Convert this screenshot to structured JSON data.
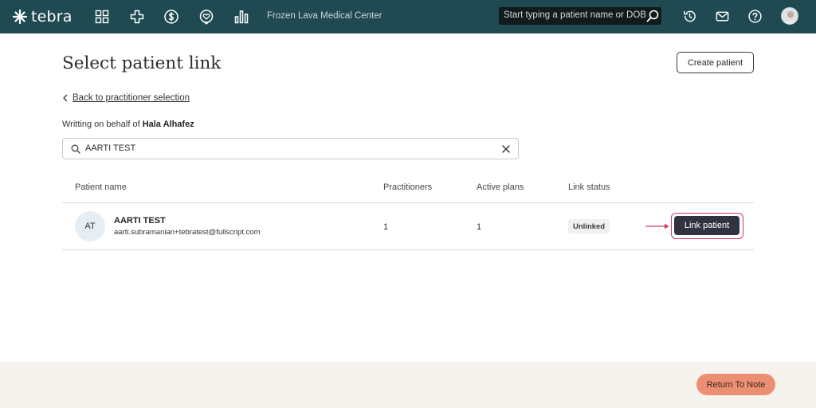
{
  "app": {
    "brand": "tebra",
    "clinic_name": "Frozen Lava Medical Center",
    "search_placeholder": "Start typing a patient name or DOB",
    "nav_icons": [
      "dashboard-grid-icon",
      "medical-cross-icon",
      "billing-dollar-icon",
      "heart-care-icon",
      "reports-chart-icon"
    ],
    "right_icons": [
      "history-icon",
      "mail-icon",
      "help-icon"
    ]
  },
  "page": {
    "title": "Select patient link",
    "create_button": "Create patient",
    "back_link": "Back to practitioner selection",
    "behalf_prefix": "Writting on behalf of ",
    "behalf_name": "Hala Alhafez"
  },
  "search": {
    "value": "AARTI TEST"
  },
  "table": {
    "columns": [
      "Patient name",
      "Practitioners",
      "Active plans",
      "Link status"
    ],
    "rows": [
      {
        "initials": "AT",
        "name": "AARTI TEST",
        "email": "aarti.subramanian+tebratest@fullscript.com",
        "practitioners": "1",
        "active_plans": "1",
        "link_status": "Unlinked",
        "action": "Link patient"
      }
    ]
  },
  "footer": {
    "return_button": "Return To Note"
  },
  "colors": {
    "topbar": "#1f4a52",
    "primary_button": "#2f3440",
    "highlight": "#d1385f",
    "return_button": "#ec8e71"
  }
}
